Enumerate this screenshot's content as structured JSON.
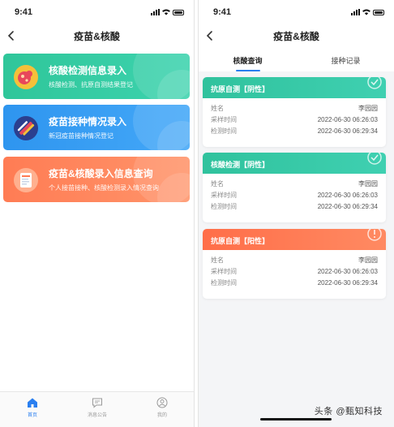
{
  "left": {
    "status_time": "9:41",
    "title": "疫苗&核酸",
    "cards": [
      {
        "title": "核酸检测信息录入",
        "subtitle": "核酸检测、抗原自测结果登记",
        "color": "#2fc69a",
        "icon": "virus-icon"
      },
      {
        "title": "疫苗接种情况录入",
        "subtitle": "新冠疫苗接种情况登记",
        "color": "#2e95ef",
        "icon": "syringe-icon"
      },
      {
        "title": "疫苗&核酸录入信息查询",
        "subtitle": "个人接苗接种、核酸检测录入情况查询",
        "color": "#ff7c54",
        "icon": "document-icon"
      }
    ],
    "tabbar": [
      {
        "label": "首页",
        "icon": "home-icon",
        "active": true
      },
      {
        "label": "消息公告",
        "icon": "message-icon",
        "active": false
      },
      {
        "label": "我的",
        "icon": "profile-icon",
        "active": false
      }
    ]
  },
  "right": {
    "status_time": "9:41",
    "title": "疫苗&核酸",
    "tabs": [
      "核酸查询",
      "接种记录"
    ],
    "active_tab": "核酸查询",
    "records": [
      {
        "title": "抗原自测【阴性】",
        "status": "negative",
        "name_label": "姓名",
        "name": "李园园",
        "sample_label": "采样时间",
        "sample_time": "2022-06-30 06:26:03",
        "test_label": "检测时间",
        "test_time": "2022-06-30 06:29:34"
      },
      {
        "title": "核酸检测【阴性】",
        "status": "negative",
        "name_label": "姓名",
        "name": "李园园",
        "sample_label": "采样时间",
        "sample_time": "2022-06-30 06:26:03",
        "test_label": "检测时间",
        "test_time": "2022-06-30 06:29:34"
      },
      {
        "title": "抗原自测【阳性】",
        "status": "positive",
        "name_label": "姓名",
        "name": "李园园",
        "sample_label": "采样时间",
        "sample_time": "2022-06-30 06:26:03",
        "test_label": "检测时间",
        "test_time": "2022-06-30 06:29:34"
      }
    ]
  },
  "watermark": "头条 @甄知科技",
  "colors": {
    "green": "#30c29d",
    "blue": "#2e95ef",
    "orange": "#ff7c54",
    "accent": "#2a7ff0"
  }
}
